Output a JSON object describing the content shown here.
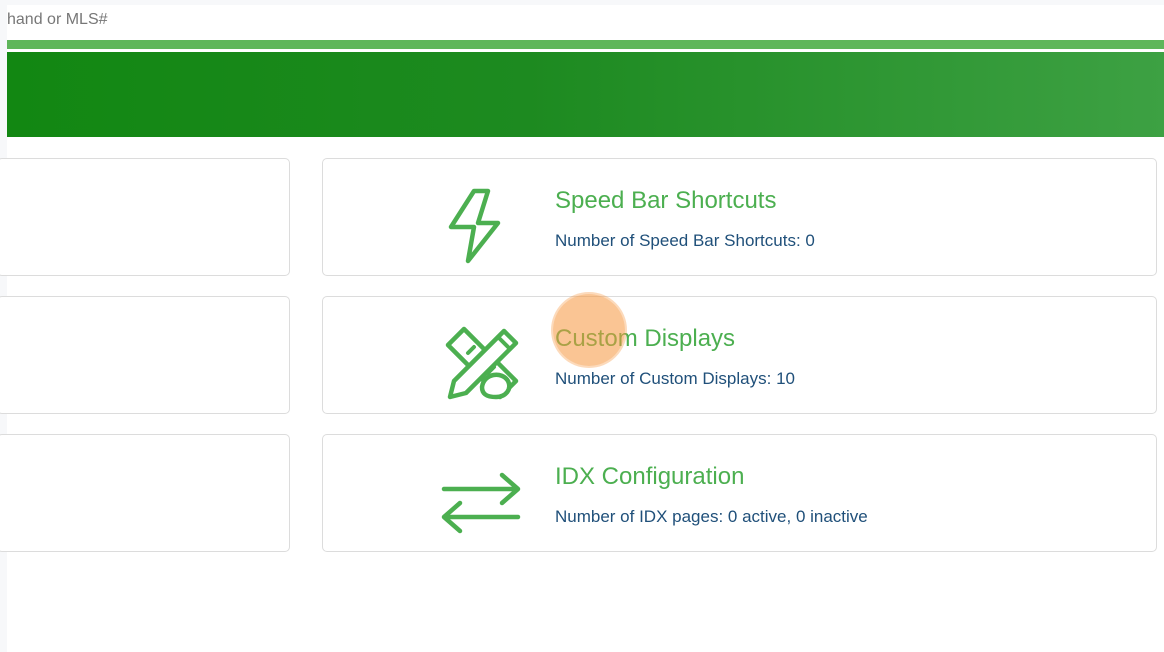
{
  "search": {
    "placeholder": "hand or MLS#"
  },
  "cards": [
    {
      "title": "Speed Bar Shortcuts",
      "subtitle": "Number of Speed Bar Shortcuts: 0",
      "icon": "lightning-bolt-icon"
    },
    {
      "title": "Custom Displays",
      "subtitle": "Number of Custom Displays: 10",
      "icon": "design-tools-icon"
    },
    {
      "title": "IDX Configuration",
      "subtitle": "Number of IDX pages: 0 active, 0 inactive",
      "icon": "swap-arrows-icon"
    }
  ],
  "colors": {
    "accent_green": "#4caf50",
    "banner_dark": "#128712",
    "banner_light": "#3da143",
    "subtitle_blue": "#20507a",
    "cursor_highlight": "#f5963c"
  }
}
